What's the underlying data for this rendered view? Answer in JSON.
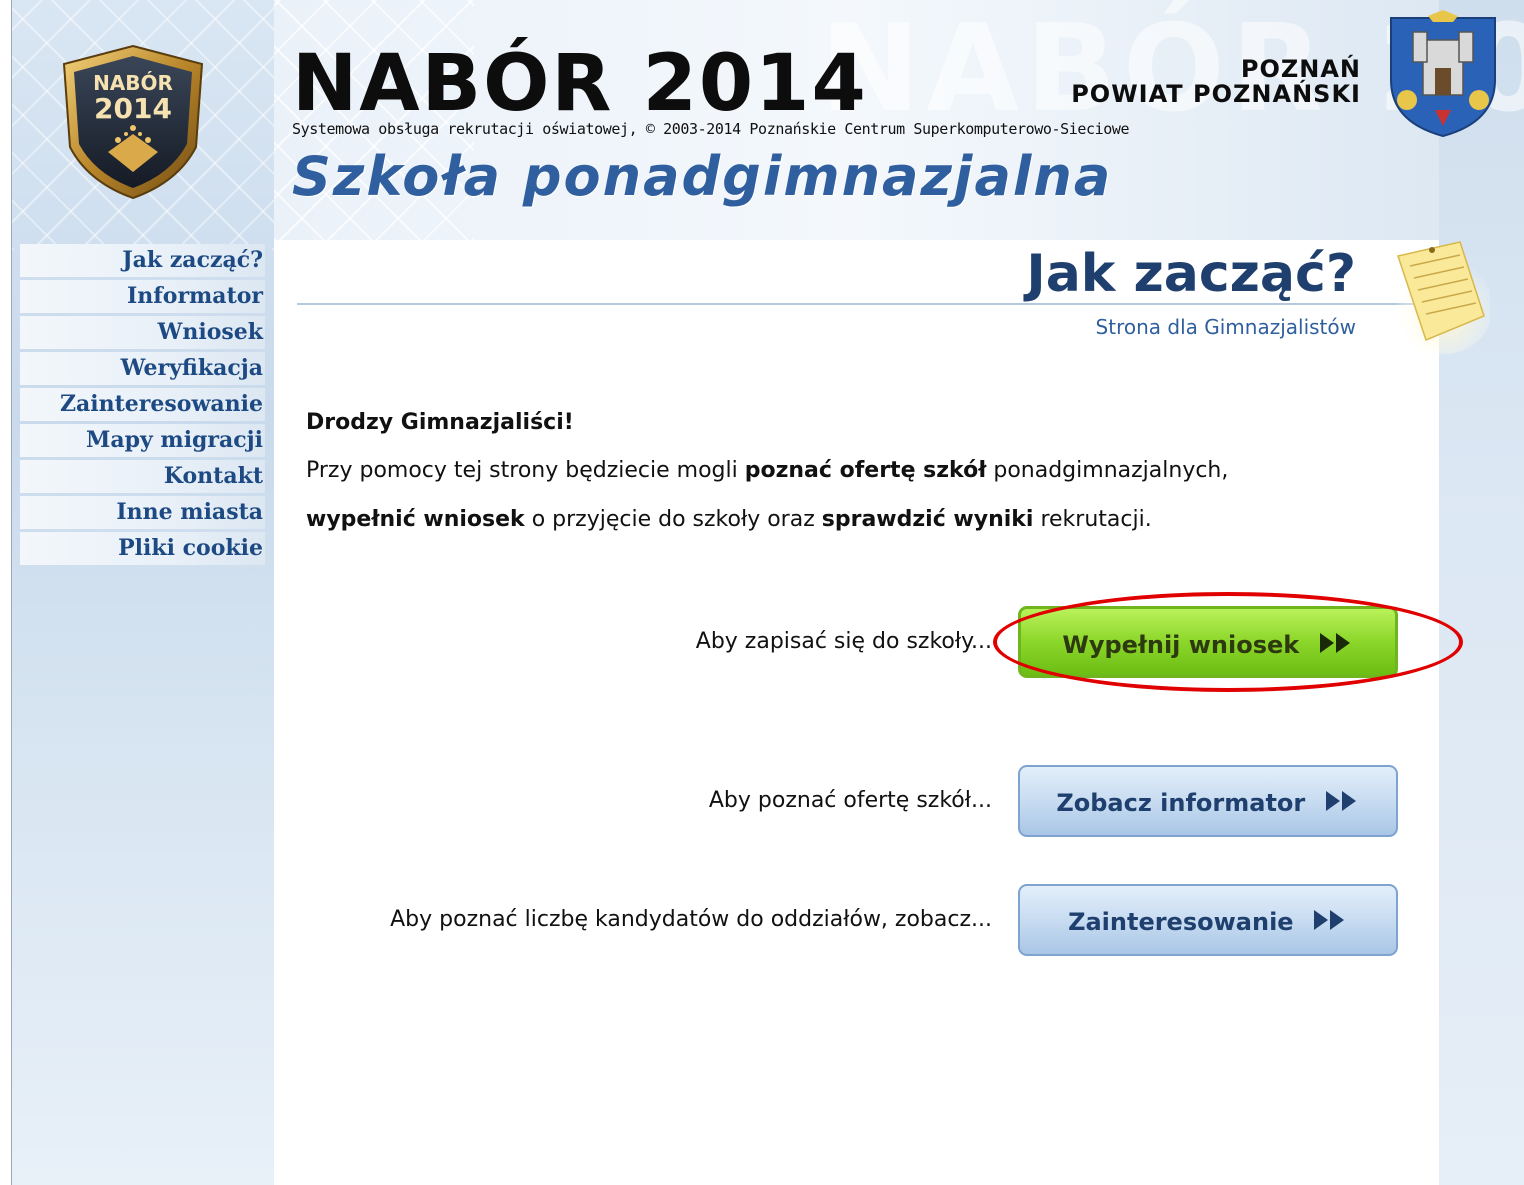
{
  "header": {
    "logo_badge_top": "NABÓR",
    "logo_badge_year": "2014",
    "title": "NABÓR 2014",
    "subtitle": "Systemowa obsługa rekrutacji oświatowej,  © 2003-2014 Poznańskie Centrum Superkomputerowo-Sieciowe",
    "city_line1": "POZNAŃ",
    "city_line2": "POWIAT POZNAŃSKI",
    "section": "Szkoła ponadgimnazjalna"
  },
  "sidebar": {
    "items": [
      {
        "label": "Jak zacząć?"
      },
      {
        "label": "Informator"
      },
      {
        "label": "Wniosek"
      },
      {
        "label": "Weryfikacja"
      },
      {
        "label": "Zainteresowanie"
      },
      {
        "label": "Mapy migracji"
      },
      {
        "label": "Kontakt"
      },
      {
        "label": "Inne miasta"
      },
      {
        "label": "Pliki cookie"
      }
    ]
  },
  "main": {
    "heading": "Jak zacząć?",
    "subheading": "Strona dla Gimnazjalistów",
    "greeting": "Drodzy Gimnazjaliści!",
    "para1_a": "Przy pomocy tej strony będziecie mogli ",
    "para1_b": "poznać ofertę szkół",
    "para1_c": " ponadgimnazjalnych,",
    "para2_a": "wypełnić wniosek",
    "para2_b": " o przyjęcie do szkoły oraz ",
    "para2_c": "sprawdzić wyniki",
    "para2_d": " rekrutacji.",
    "actions": [
      {
        "prompt": "Aby zapisać się do szkoły...",
        "button": "Wypełnij wniosek"
      },
      {
        "prompt": "Aby poznać ofertę szkół...",
        "button": "Zobacz informator"
      },
      {
        "prompt": "Aby poznać liczbę kandydatów do oddziałów, zobacz...",
        "button": "Zainteresowanie"
      }
    ]
  },
  "colors": {
    "nav_text": "#1e4a84",
    "heading": "#1f3f6e",
    "accent_blue": "#2f5f9e",
    "button_green": "#8cd62a",
    "button_blue": "#c8dcf1",
    "highlight": "#e00000"
  },
  "icons": [
    "nabor-badge-icon",
    "coat-of-arms-icon",
    "note-paper-icon",
    "double-arrow-icon"
  ]
}
